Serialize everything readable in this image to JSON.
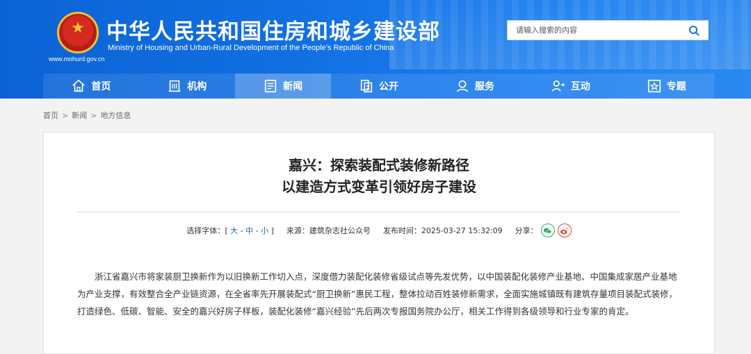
{
  "header": {
    "site_url": "www.mohurd.gov.cn",
    "title": "中华人民共和国住房和城乡建设部",
    "subtitle": "Ministry of Housing and Urban-Rural Development of the People’s Republic of China",
    "search": {
      "placeholder": "请输入搜索的内容",
      "icon": "search-icon"
    },
    "brand_color": "#1270e2"
  },
  "nav": {
    "items": [
      {
        "label": "首页",
        "icon": "home-icon"
      },
      {
        "label": "机构",
        "icon": "building-icon"
      },
      {
        "label": "新闻",
        "icon": "news-icon",
        "active": true
      },
      {
        "label": "公开",
        "icon": "document-icon"
      },
      {
        "label": "服务",
        "icon": "service-icon"
      },
      {
        "label": "互动",
        "icon": "interaction-icon"
      },
      {
        "label": "专题",
        "icon": "star-icon"
      }
    ]
  },
  "breadcrumb": [
    "首页",
    "新闻",
    "地方信息"
  ],
  "article": {
    "title_line1": "嘉兴：探索装配式装修新路径",
    "title_line2": "以建造方式变革引领好房子建设",
    "font_size_label": "选择字体：",
    "font_large": "大",
    "font_medium": "中",
    "font_small": "小",
    "source_label": "来源：",
    "source": "建筑杂志社公众号",
    "publish_label": "发布时间：",
    "publish_time": "2025-03-27 15:32:09",
    "share_label": "分享：",
    "paragraph": "浙江省嘉兴市将家装厨卫换新作为以旧换新工作切入点，深度借力装配化装修省级试点等先发优势，以中国装配化装修产业基地、中国集成家居产业基地为产业支撑，有效整合全产业链资源，在全省率先开展装配式“厨卫换新”惠民工程，整体拉动百姓装修新需求，全面实施城镇既有建筑存量项目装配式装修，打造绿色、低碳、智能、安全的嘉兴好房子样板，装配化装修“嘉兴经验”先后两次专报国务院办公厅，相关工作得到各级领导和行业专家的肯定。"
  }
}
